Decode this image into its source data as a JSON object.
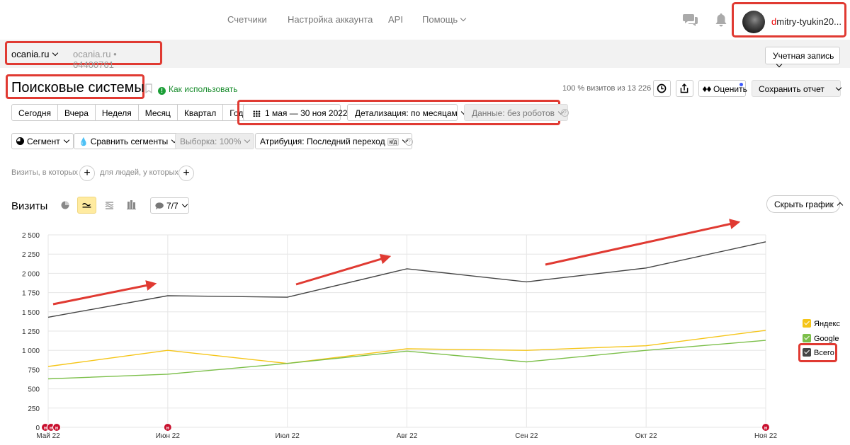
{
  "nav": {
    "items": [
      "Счетчики",
      "Настройка аккаунта",
      "API",
      "Помощь"
    ],
    "user_initial": "d",
    "user_rest": "mitry-tyukin20..."
  },
  "counter": {
    "site": "ocania.ru",
    "site_gray": "ocania.ru",
    "separator": "•",
    "counter_id": "64400761",
    "account_label": "Учетная запись"
  },
  "report": {
    "title": "Поисковые системы",
    "howto": "Как использовать",
    "howto_icon": "!",
    "visits_note": "100 % визитов из 13 226",
    "rate_label": "Оценить",
    "save_label": "Сохранить отчет"
  },
  "periods": [
    "Сегодня",
    "Вчера",
    "Неделя",
    "Месяц",
    "Квартал",
    "Год"
  ],
  "filters": {
    "date_range": "1 мая — 30 ноя 2022",
    "detail": "Детализация: по месяцам",
    "data": "Данные: без роботов",
    "help": "?"
  },
  "segments": {
    "segment": "Сегмент",
    "compare": "Сравнить сегменты",
    "sample": "Выборка: 100%",
    "attribution": "Атрибуция: Последний переход",
    "kd": "к/д"
  },
  "filter_row": {
    "visits_who": "Визиты, в которых",
    "people_who": "для людей, у которых",
    "plus": "+"
  },
  "chart_header": {
    "title": "Визиты",
    "metrics": "7/7",
    "hide_chart": "Скрыть график"
  },
  "chart_data": {
    "type": "line",
    "categories": [
      "Май 22",
      "Июн 22",
      "Июл 22",
      "Авг 22",
      "Сен 22",
      "Окт 22",
      "Ноя 22"
    ],
    "ylim": [
      0,
      2500
    ],
    "yticks": [
      0,
      250,
      500,
      750,
      1000,
      1250,
      1500,
      1750,
      2000,
      2250,
      2500
    ],
    "ytick_labels": [
      "0",
      "250",
      "500",
      "750",
      "1 000",
      "1 250",
      "1 500",
      "1 750",
      "2 000",
      "2 250",
      "2 500"
    ],
    "grid": true,
    "legend_position": "right",
    "series": [
      {
        "name": "Яндекс",
        "color": "#f5c518",
        "values": [
          790,
          1000,
          830,
          1020,
          1000,
          1060,
          1260
        ]
      },
      {
        "name": "Google",
        "color": "#7cbf4a",
        "values": [
          630,
          690,
          830,
          990,
          850,
          1000,
          1130
        ]
      },
      {
        "name": "Всего",
        "color": "#444444",
        "values": [
          1430,
          1710,
          1690,
          2060,
          1890,
          2070,
          2410
        ]
      }
    ],
    "markers": [
      {
        "category_index": 0,
        "count": 3,
        "label": "н"
      },
      {
        "category_index": 1,
        "count": 1,
        "label": "н"
      },
      {
        "category_index": 6,
        "count": 1,
        "label": "н"
      }
    ],
    "accent_color": "#e03a32"
  }
}
